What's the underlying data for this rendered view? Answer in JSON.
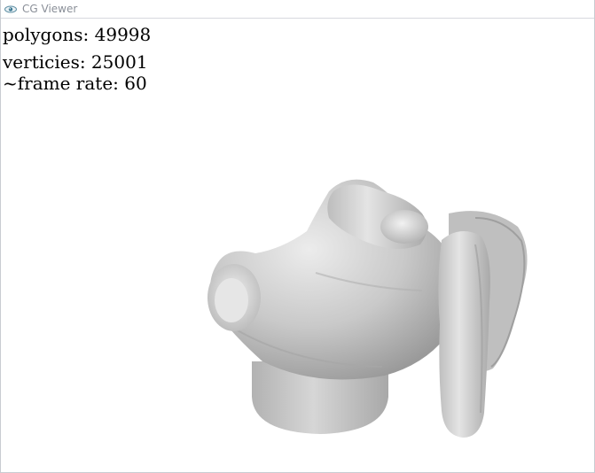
{
  "window": {
    "title": "CG Viewer",
    "icon": "eye-logo-icon"
  },
  "stats": {
    "polygons": "polygons: 49998",
    "verticies": "verticies: 25001",
    "frame_rate": "~frame rate: 60"
  },
  "model": {
    "subject": "3d-hand-model",
    "shade_color": "#c4c4c4"
  }
}
